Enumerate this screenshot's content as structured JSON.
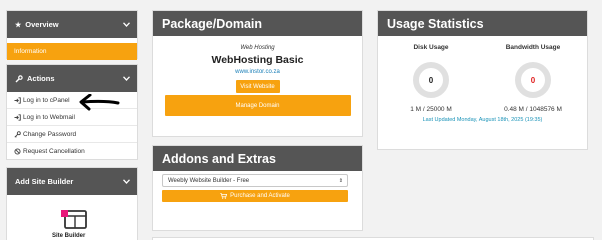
{
  "sidebar": {
    "overview": {
      "title": "Overview",
      "items": [
        {
          "label": "Information",
          "active": true
        }
      ]
    },
    "actions": {
      "title": "Actions",
      "items": [
        {
          "label": "Log in to cPanel",
          "icon": "sign-in-icon"
        },
        {
          "label": "Log in to Webmail",
          "icon": "sign-in-icon"
        },
        {
          "label": "Change Password",
          "icon": "key-icon"
        },
        {
          "label": "Request Cancellation",
          "icon": "ban-icon"
        }
      ]
    },
    "site_builder": {
      "title": "Add Site Builder",
      "label": "Site Builder"
    }
  },
  "package": {
    "title": "Package/Domain",
    "type": "Web Hosting",
    "name": "WebHosting Basic",
    "domain": "www.instor.co.za",
    "visit_label": "Visit Website",
    "manage_label": "Manage Domain"
  },
  "addons": {
    "title": "Addons and Extras",
    "select_value": "Weebly Website Builder - Free",
    "purchase_label": "Purchase and Activate"
  },
  "usage": {
    "title": "Usage Statistics",
    "disk": {
      "title": "Disk Usage",
      "gauge_value": "0",
      "value": "1 M / 25000 M"
    },
    "bandwidth": {
      "title": "Bandwidth Usage",
      "gauge_value": "0",
      "value": "0.48 M / 1048576 M"
    },
    "updated": "Last Updated Monday, August 18th, 2025 (19:35)"
  },
  "colors": {
    "accent": "#f7a20f",
    "header": "#555555",
    "link": "#1a7fb8",
    "gauge_zero_bandwidth": "#e02020"
  }
}
